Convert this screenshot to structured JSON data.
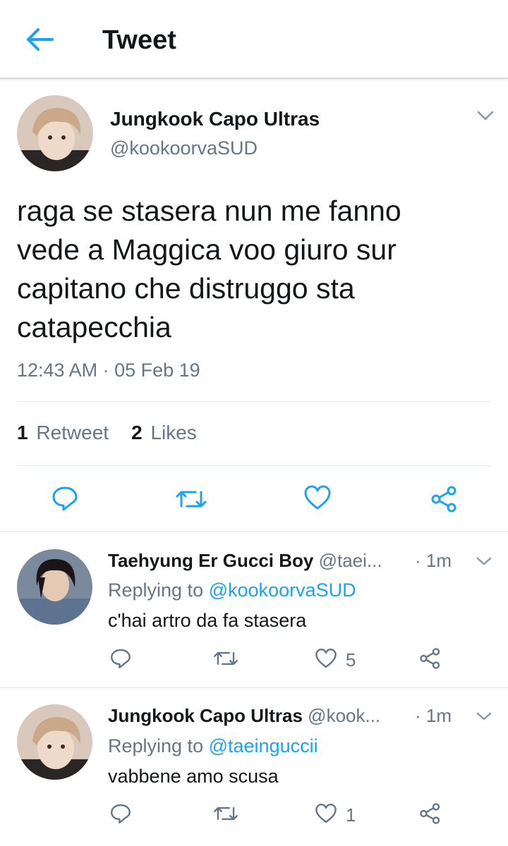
{
  "header": {
    "title": "Tweet"
  },
  "tweet": {
    "author_name": "Jungkook Capo Ultras",
    "author_handle": "@kookoorvaSUD",
    "text": "raga se stasera nun me fanno vede a Maggica voo giuro sur capitano che distruggo sta catapecchia",
    "timestamp": "12:43 AM · 05 Feb 19",
    "retweet_count": "1",
    "retweet_label": "Retweet",
    "like_count": "2",
    "like_label": "Likes"
  },
  "replies": [
    {
      "author_name": "Taehyung Er Gucci Boy",
      "author_handle": "@taei...",
      "time": "· 1m",
      "replying_prefix": "Replying to",
      "replying_to": "@kookoorvaSUD",
      "text": "c'hai artro da fa stasera",
      "like_count": "5"
    },
    {
      "author_name": "Jungkook Capo Ultras",
      "author_handle": "@kook...",
      "time": "· 1m",
      "replying_prefix": "Replying to",
      "replying_to": "@taeinguccii",
      "text": "vabbene amo scusa",
      "like_count": "1"
    }
  ],
  "icons": {
    "back": "arrow-left-icon",
    "reply": "reply-icon",
    "retweet": "retweet-icon",
    "like": "heart-icon",
    "share": "share-icon",
    "more": "chevron-down-icon"
  },
  "colors": {
    "accent": "#1da1f2",
    "secondary_text": "#657786",
    "primary_text": "#14171a"
  }
}
